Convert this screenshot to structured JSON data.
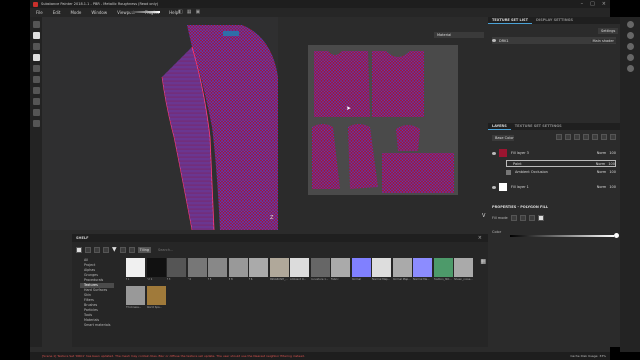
{
  "window": {
    "title": "Substance Painter 2018.1.1 - PBR - Metallic Roughness (Read only)"
  },
  "menubar": {
    "items": [
      "File",
      "Edit",
      "Mode",
      "Window",
      "Viewport",
      "Plugins",
      "Help"
    ]
  },
  "viewport": {
    "uv_dropdown": "Material",
    "axis_label_3d": "Z",
    "axis_label_2d": "V"
  },
  "right_panel": {
    "tabs": [
      "TEXTURE SET LIST",
      "DISPLAY SETTINGS"
    ],
    "settings_button": "Settings",
    "texture_set": {
      "name": "DRK1",
      "shader": "Main shader"
    },
    "layer_tabs": [
      "LAYERS",
      "TEXTURE SET SETTINGS"
    ],
    "channel_dropdown": "Base Color",
    "layers": [
      {
        "name": "Fill layer 3",
        "blend": "Norm",
        "opacity": "100",
        "thumb_color": "#9a1530"
      },
      {
        "name": "Paint",
        "blend": "Norm",
        "opacity": "100",
        "thumb_color": "#ffffff"
      },
      {
        "name": "Ambient Occlusion",
        "blend": "Norm",
        "opacity": "100",
        "thumb_color": "#777777"
      },
      {
        "name": "Fill layer 1",
        "blend": "Norm",
        "opacity": "100",
        "thumb_color": "#ffffff"
      }
    ],
    "properties": {
      "title": "PROPERTIES - POLYGON FILL",
      "fill_mode_label": "Fill mode",
      "color_label": "Color"
    }
  },
  "shelf": {
    "title": "SHELF",
    "filter_tag": "Tiling",
    "search_placeholder": "Search...",
    "categories": [
      "All",
      "Project",
      "Alphas",
      "Grunges",
      "Procedurals",
      "Textures",
      "Hard Surfaces",
      "Skin",
      "Filters",
      "Brushes",
      "Particles",
      "Tools",
      "Materials",
      "Smart materials"
    ],
    "selected_category": "Textures",
    "items": [
      {
        "label": "f 1",
        "color": "#f0f0f0"
      },
      {
        "label": "f 2 1",
        "color": "#111111"
      },
      {
        "label": "f 3",
        "color": "#555555"
      },
      {
        "label": "f 4",
        "color": "#777777"
      },
      {
        "label": "f 5",
        "color": "#888888"
      },
      {
        "label": "8 8",
        "color": "#999999"
      },
      {
        "label": "f 6",
        "color": "#aaaaaa"
      },
      {
        "label": "ANKAROSH_...",
        "color": "#b0a89a"
      },
      {
        "label": "Ambient O...",
        "color": "#dcdcdc"
      },
      {
        "label": "Curvature 1...",
        "color": "#666666"
      },
      {
        "label": "Fabric",
        "color": "#aaaaaa"
      },
      {
        "label": "Normal",
        "color": "#8080ff"
      },
      {
        "label": "Normal Map...",
        "color": "#dddddd"
      },
      {
        "label": "Normal Map...",
        "color": "#aaaaaa"
      },
      {
        "label": "Normal Ma...",
        "color": "#8c8cff"
      },
      {
        "label": "Position_ISO...",
        "color": "#4d9a6a"
      },
      {
        "label": "Sheen_noise...",
        "color": "#aaaaaa"
      },
      {
        "label": "Thickness...",
        "color": "#999999"
      },
      {
        "label": "World Spa...",
        "color": "#a07a3a"
      }
    ]
  },
  "statusbar": {
    "warning": "[Scene 1] Texture Set 'DRK1' has been updated. The mesh may contain tiles. Blur or diffuse the texture set update. The user should use the Nearest neighbor filtering instead.",
    "cache": "Cache Disk Usage: 33%"
  },
  "colors": {
    "accent": "#4ba3d8",
    "garment": "#a3143a",
    "garment_lines": "#3d4bd9"
  }
}
